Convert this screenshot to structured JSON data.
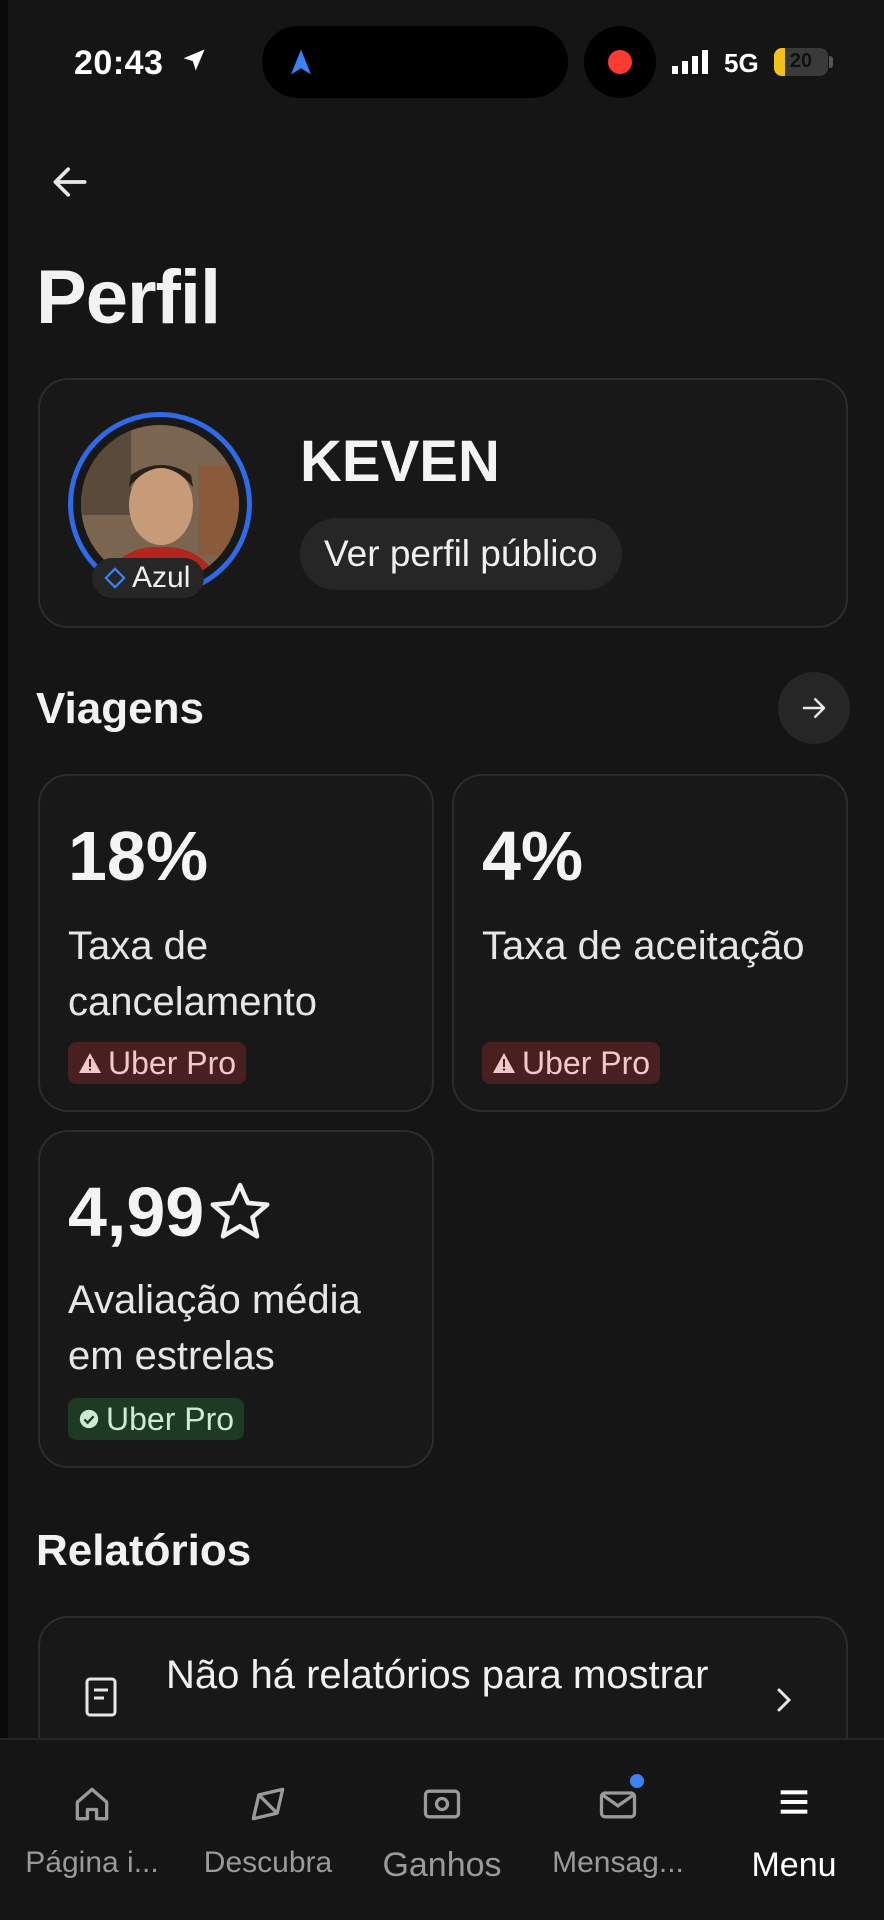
{
  "status_bar": {
    "time": "20:43",
    "network": "5G",
    "battery": "20",
    "battery_level": 0.2,
    "recording_color": "#ff3b30"
  },
  "header": {
    "back_icon": "arrow-left-icon",
    "title": "Perfil"
  },
  "profile": {
    "name": "KEVEN",
    "tier": "Azul",
    "tier_color": "#2f6be8",
    "public_profile_label": "Ver perfil público"
  },
  "trips": {
    "title": "Viagens",
    "stats": [
      {
        "value": "18%",
        "label": "Taxa de cancelamento",
        "badge": "Uber Pro",
        "badge_status": "warning"
      },
      {
        "value": "4%",
        "label": "Taxa de aceitação",
        "badge": "Uber Pro",
        "badge_status": "warning"
      },
      {
        "value": "4,99",
        "label": "Avaliação média em estrelas",
        "badge": "Uber Pro",
        "badge_status": "ok",
        "icon": "star-icon"
      }
    ]
  },
  "reports": {
    "title": "Relatórios",
    "empty_text": "Não há relatórios para mostrar"
  },
  "bottom_nav": {
    "items": [
      {
        "label": "Página i...",
        "icon": "home-icon"
      },
      {
        "label": "Descubra",
        "icon": "compass-icon"
      },
      {
        "label": "Ganhos",
        "icon": "money-icon"
      },
      {
        "label": "Mensag...",
        "icon": "mail-icon"
      },
      {
        "label": "Menu",
        "icon": "hamburger-icon",
        "active": true
      }
    ]
  }
}
